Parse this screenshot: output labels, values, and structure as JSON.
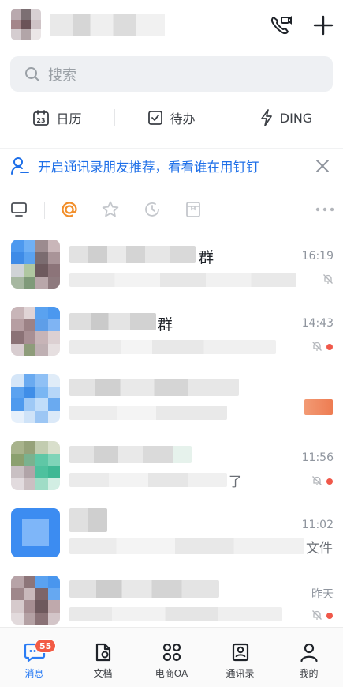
{
  "search": {
    "placeholder": "搜索"
  },
  "quick_actions": [
    {
      "label": "日历",
      "icon": "calendar-icon",
      "icon_text": "23"
    },
    {
      "label": "待办",
      "icon": "todo-check-icon"
    },
    {
      "label": "DING",
      "icon": "ding-lightning-icon"
    }
  ],
  "banner": {
    "text": "开启通讯录朋友推荐，看看谁在用钉钉"
  },
  "filters": [
    "desktop-icon",
    "at-icon",
    "star-icon",
    "recent-clock-icon",
    "bookmark-icon",
    "more-dots-icon"
  ],
  "colors": {
    "accent": "#1e6fe8",
    "at": "#f28f2b",
    "badge": "#f25b45",
    "dot": "#f0584a"
  },
  "conversations": [
    {
      "title_suffix": "群",
      "subtitle_suffix": "",
      "time": "16:19",
      "muted": true,
      "unread_dot": false
    },
    {
      "title_suffix": "群",
      "subtitle_suffix": "",
      "time": "14:43",
      "muted": true,
      "unread_dot": true
    },
    {
      "title_suffix": "",
      "subtitle_suffix": "",
      "time": "",
      "muted": false,
      "unread_dot": false
    },
    {
      "title_suffix": "",
      "subtitle_suffix": "了",
      "time": "11:56",
      "muted": true,
      "unread_dot": true
    },
    {
      "title_suffix": "",
      "subtitle_suffix": "文件",
      "time": "11:02",
      "muted": false,
      "unread_dot": false
    },
    {
      "title_suffix": "",
      "subtitle_suffix": "",
      "time": "昨天",
      "muted": true,
      "unread_dot": true
    }
  ],
  "bottom_nav": [
    {
      "label": "消息",
      "icon": "message-icon",
      "badge": "55",
      "active": true
    },
    {
      "label": "文档",
      "icon": "document-icon",
      "active": false
    },
    {
      "label": "电商OA",
      "icon": "apps-grid-icon",
      "active": false
    },
    {
      "label": "通讯录",
      "icon": "contacts-icon",
      "active": false
    },
    {
      "label": "我的",
      "icon": "profile-icon",
      "active": false
    }
  ]
}
